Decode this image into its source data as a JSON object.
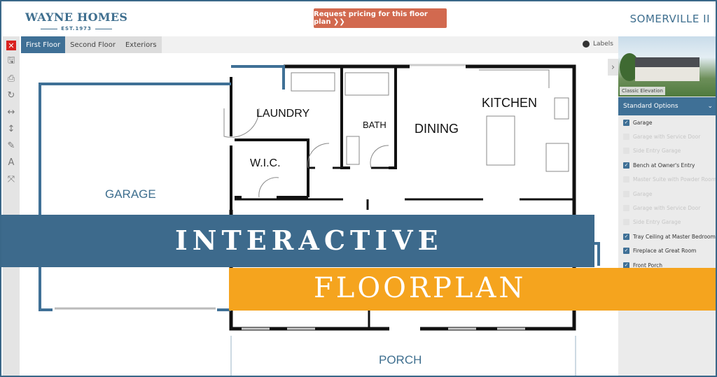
{
  "header": {
    "brand": "WAYNE HOMES",
    "brand_sub": "EST.1973",
    "cta": "Request pricing for this floor plan ❯❯",
    "plan_name": "SOMERVILLE II"
  },
  "toolbar": {
    "tools": [
      {
        "icon": "close-icon",
        "glyph": "✕"
      },
      {
        "icon": "save-icon",
        "glyph": "🖫"
      },
      {
        "icon": "print-icon",
        "glyph": "⎙"
      },
      {
        "icon": "rotate-icon",
        "glyph": "↻"
      },
      {
        "icon": "flip-horizontal-icon",
        "glyph": "↔"
      },
      {
        "icon": "flip-vertical-icon",
        "glyph": "↕"
      },
      {
        "icon": "pencil-icon",
        "glyph": "✎"
      },
      {
        "icon": "text-icon",
        "glyph": "A"
      },
      {
        "icon": "collapse-icon",
        "glyph": "⤧"
      }
    ]
  },
  "tabs": [
    {
      "label": "First Floor",
      "active": true
    },
    {
      "label": "Second Floor"
    },
    {
      "label": "Exteriors"
    }
  ],
  "labels_toggle": "Labels",
  "rooms": {
    "laundry": "LAUNDRY",
    "bath": "BATH",
    "dining": "DINING",
    "kitchen": "KITCHEN",
    "wic": "W.I.C.",
    "garage": "GARAGE",
    "porch": "PORCH"
  },
  "side": {
    "elevation_caption": "Classic Elevation",
    "options_title": "Standard Options",
    "options": [
      {
        "label": "Garage",
        "checked": true
      },
      {
        "label": "Garage with Service Door",
        "checked": false
      },
      {
        "label": "Side Entry Garage",
        "checked": false
      },
      {
        "label": "Bench at Owner's Entry",
        "checked": true
      },
      {
        "label": "Master Suite with Powder Room",
        "checked": false
      },
      {
        "label": "Garage",
        "checked": false
      },
      {
        "label": "Garage with Service Door",
        "checked": false
      },
      {
        "label": "Side Entry Garage",
        "checked": false
      },
      {
        "label": "Tray Ceiling at Master Bedroom",
        "checked": true
      },
      {
        "label": "Fireplace at Great Room",
        "checked": true
      },
      {
        "label": "Front Porch",
        "checked": true
      }
    ]
  },
  "banner": {
    "line1": "INTERACTIVE",
    "line2": "FLOORPLAN"
  },
  "colors": {
    "brand_blue": "#3f7096",
    "cta": "#d2694f",
    "orange": "#f5a41e",
    "banner_blue": "#3d6a8c"
  }
}
